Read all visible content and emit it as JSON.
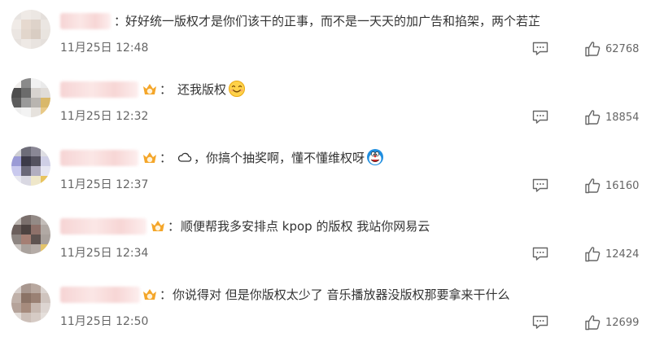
{
  "comments": [
    {
      "text": "好好统一版权才是你们该干的正事，而不是一天天的加广告和掐架，两个若芷",
      "time": "11月25日 12:48",
      "likes": "62768",
      "has_badge": false,
      "emoji": null
    },
    {
      "text": "还我版权",
      "time": "11月25日 12:32",
      "likes": "18854",
      "has_badge": true,
      "emoji": "smile-emoji"
    },
    {
      "text": "，你搞个抽奖啊，懂不懂维权呀",
      "time": "11月25日 12:37",
      "likes": "16160",
      "has_badge": true,
      "emoji": "doraemon-emoji",
      "lead_icon": "cloud-icon"
    },
    {
      "text": "顺便帮我多安排点 kpop 的版权 我站你网易云",
      "time": "11月25日 12:34",
      "likes": "12424",
      "has_badge": true,
      "emoji": null
    },
    {
      "text": "你说得对 但是你版权太少了 音乐播放器没版权那要拿来干什么",
      "time": "11月25日 12:50",
      "likes": "12699",
      "has_badge": true,
      "emoji": null
    }
  ],
  "colon": "：",
  "colors": {
    "text": "#333333",
    "meta": "#666666",
    "badge": "#f4a62a"
  }
}
